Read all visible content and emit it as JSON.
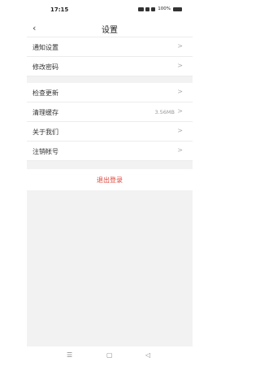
{
  "status": {
    "time": "17:15",
    "battery": "100%"
  },
  "nav": {
    "back_icon": "chevron-left-icon",
    "title": "设置"
  },
  "section1": [
    {
      "label": "通知设置"
    },
    {
      "label": "修改密码"
    }
  ],
  "section2": [
    {
      "label": "检查更新"
    },
    {
      "label": "清理缓存",
      "value": "3.56MB"
    },
    {
      "label": "关于我们"
    },
    {
      "label": "注销帐号"
    }
  ],
  "logout": {
    "label": "退出登录",
    "color": "#e0443a"
  },
  "system_nav": {
    "menu": "☰",
    "home": "▢",
    "back": "◁"
  }
}
